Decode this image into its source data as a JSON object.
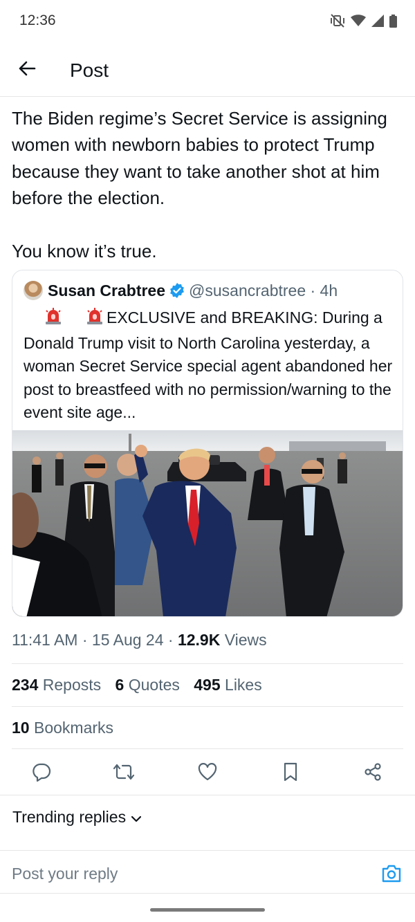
{
  "status_bar": {
    "time": "12:36",
    "icons": [
      "mute-vibrate-icon",
      "wifi-icon",
      "cell-signal-icon",
      "battery-icon"
    ]
  },
  "header": {
    "title": "Post",
    "back_icon": "arrow-left-icon"
  },
  "post": {
    "text": "The Biden regime’s Secret Service is assigning women with newborn babies to protect Trump because they want to take another shot at him before the election.\n\nYou know it’s true.",
    "timestamp": "11:41 AM · 15 Aug 24 · ",
    "views_count": "12.9K",
    "views_label": " Views"
  },
  "quoted_post": {
    "author_name": "Susan Crabtree",
    "verified": true,
    "handle_time": "@susancrabtree · 4h",
    "emoji": [
      "🚨",
      "🚨"
    ],
    "text": "EXCLUSIVE and BREAKING: During a Donald Trump visit to North Carolina yesterday, a woman Secret Service special agent abandoned her post to breastfeed with no permission/warning to the event site age..."
  },
  "stats": {
    "reposts_count": "234",
    "reposts_label": " Reposts",
    "quotes_count": "6",
    "quotes_label": " Quotes",
    "likes_count": "495",
    "likes_label": " Likes",
    "bookmarks_count": "10",
    "bookmarks_label": " Bookmarks"
  },
  "actions": [
    "reply-icon",
    "repost-icon",
    "like-icon",
    "bookmark-icon",
    "share-icon"
  ],
  "replies": {
    "trending_label": "Trending replies",
    "placeholder": "Post your reply"
  },
  "colors": {
    "text": "#0f1419",
    "secondary": "#536471",
    "accent": "#1d9bf0",
    "divider": "#e6e6e6"
  }
}
